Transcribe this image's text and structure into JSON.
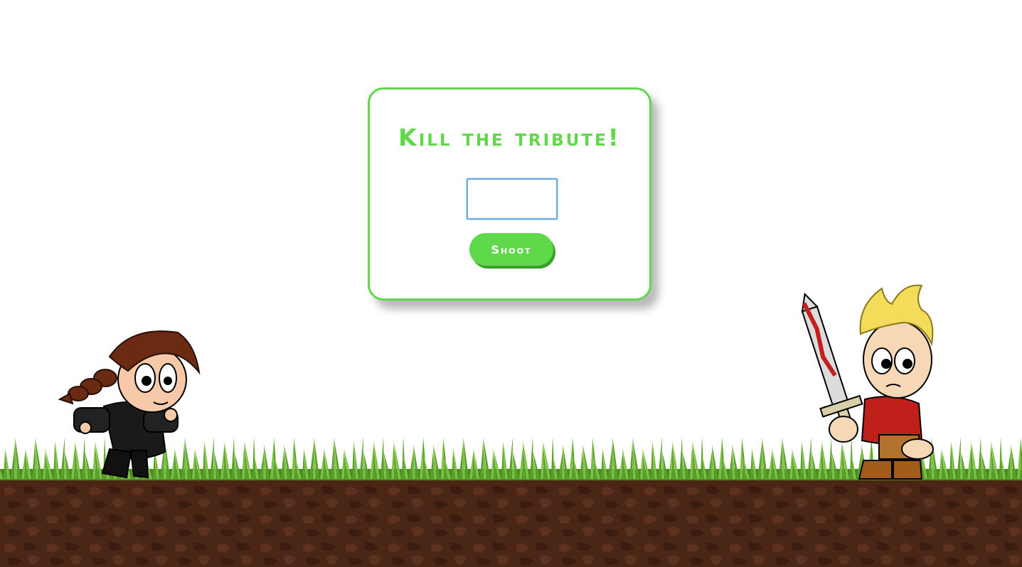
{
  "panel": {
    "title": "Kill the tribute!",
    "input_value": "",
    "button_label": "Shoot"
  },
  "colors": {
    "accent": "#5fd94a",
    "grass": "#5aa02c",
    "dirt": "#4a2616"
  },
  "sprites": {
    "player": "girl-with-braid-character",
    "enemy": "blond-boy-with-bloody-sword-character"
  }
}
